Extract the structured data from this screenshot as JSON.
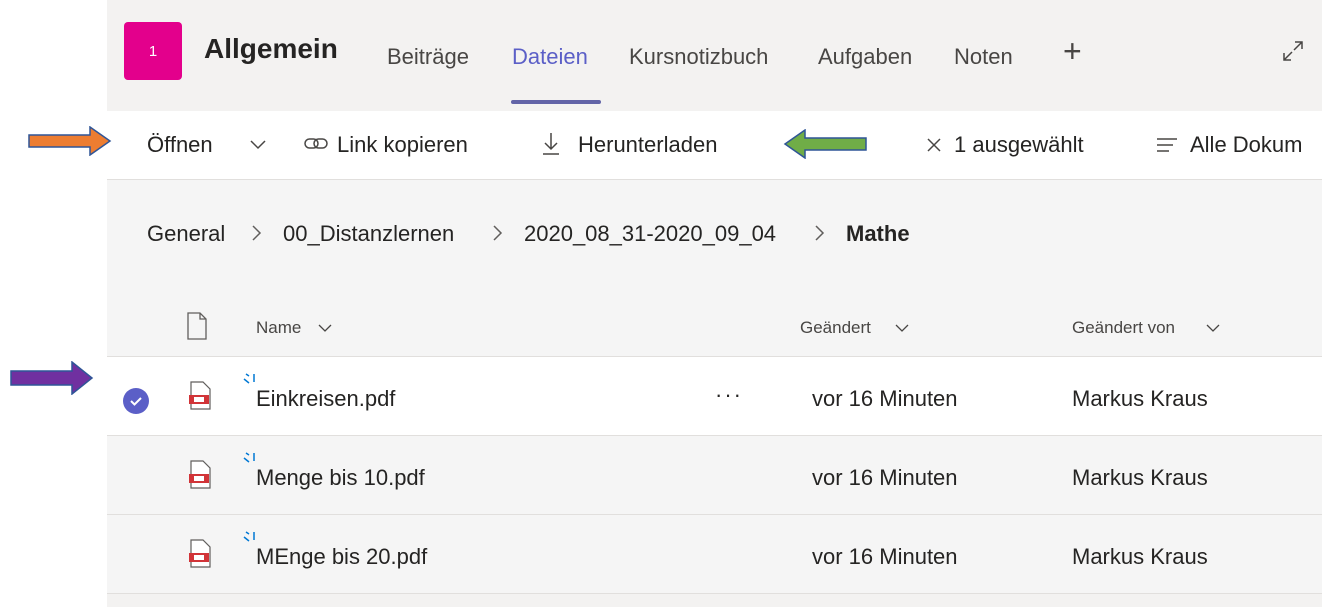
{
  "header": {
    "team_number": "1",
    "channel_name": "Allgemein",
    "tabs": [
      "Beiträge",
      "Dateien",
      "Kursnotizbuch",
      "Aufgaben",
      "Noten"
    ],
    "active_tab": "Dateien",
    "add_tab_icon": "plus-icon",
    "expand_icon": "expand-icon",
    "team_color": "#e3008c"
  },
  "toolbar": {
    "open_label": "Öffnen",
    "copy_link_label": "Link kopieren",
    "download_label": "Herunterladen",
    "selected_count_label": "1 ausgewählt",
    "view_label": "Alle Dokum"
  },
  "breadcrumb": {
    "items": [
      "General",
      "00_Distanzlernen",
      "2020_08_31-2020_09_04"
    ],
    "current": "Mathe"
  },
  "columns": {
    "name": "Name",
    "modified": "Geändert",
    "modified_by": "Geändert von"
  },
  "files": [
    {
      "name": "Einkreisen.pdf",
      "modified": "vor 16 Minuten",
      "modified_by": "Markus Kraus",
      "selected": true
    },
    {
      "name": "Menge bis 10.pdf",
      "modified": "vor 16 Minuten",
      "modified_by": "Markus Kraus",
      "selected": false
    },
    {
      "name": "MEnge bis 20.pdf",
      "modified": "vor 16 Minuten",
      "modified_by": "Markus Kraus",
      "selected": false
    }
  ],
  "colors": {
    "accent": "#5b5fc7",
    "arrow_orange": "#ed7d31",
    "arrow_green": "#70ad47",
    "arrow_purple": "#7030a0"
  }
}
